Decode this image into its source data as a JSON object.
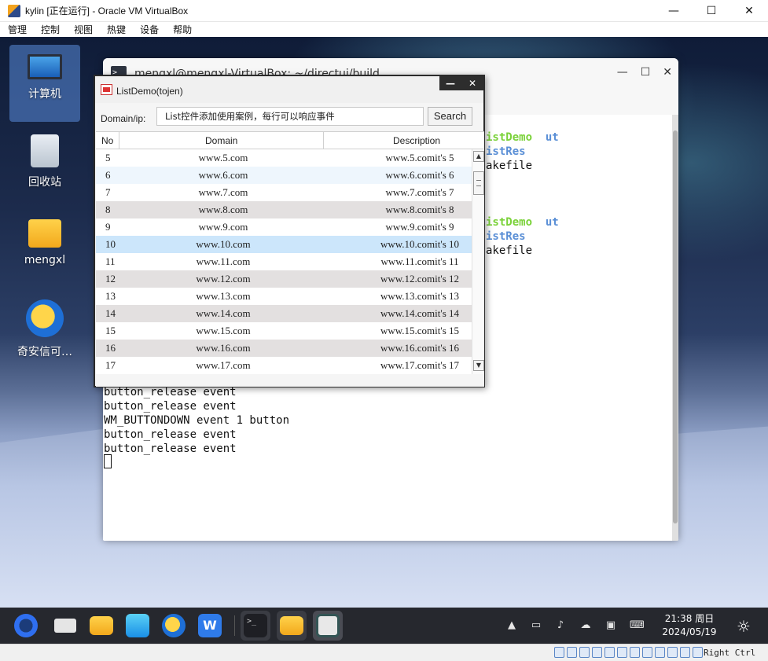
{
  "host_window": {
    "title": "kylin [正在运行] - Oracle VM VirtualBox",
    "menu": [
      "管理",
      "控制",
      "视图",
      "热键",
      "设备",
      "帮助"
    ]
  },
  "desktop_icons": [
    {
      "label": "计算机",
      "icon": "computer-icon"
    },
    {
      "label": "回收站",
      "icon": "recycle-bin-icon"
    },
    {
      "label": "mengxl",
      "icon": "home-folder-icon"
    },
    {
      "label": "奇安信可…",
      "icon": "qianxin-browser-icon"
    }
  ],
  "terminal": {
    "title": "mengxl@mengxl-VirtualBox: ~/directui/build",
    "partial_lines": [
      {
        "green": "istDemo",
        "extra": "ut"
      },
      {
        "blue": "istRes"
      },
      {
        "plain": "akefile"
      },
      {
        "green": "istDemo",
        "extra": "ut"
      },
      {
        "blue": "istRes"
      },
      {
        "plain": "akefile"
      }
    ],
    "lines": [
      "button_release event",
      "button_release event",
      "WM_BUTTONDOWN event 1 button",
      "button_release event",
      "button_release event"
    ]
  },
  "listdemo": {
    "title": "ListDemo(tojen)",
    "domain_label": "Domain/ip:",
    "search_value": "List控件添加使用案例，每行可以响应事件",
    "search_button": "Search",
    "columns": [
      "No",
      "Domain",
      "Description"
    ],
    "rows": [
      {
        "no": "5",
        "domain": "www.5.com",
        "desc": "www.5.comit's 5",
        "style": "white"
      },
      {
        "no": "6",
        "domain": "www.6.com",
        "desc": "www.6.comit's 6",
        "style": "blue"
      },
      {
        "no": "7",
        "domain": "www.7.com",
        "desc": "www.7.comit's 7",
        "style": "white"
      },
      {
        "no": "8",
        "domain": "www.8.com",
        "desc": "www.8.comit's 8",
        "style": "grey"
      },
      {
        "no": "9",
        "domain": "www.9.com",
        "desc": "www.9.comit's 9",
        "style": "white"
      },
      {
        "no": "10",
        "domain": "www.10.com",
        "desc": "www.10.comit's 10",
        "style": "selected"
      },
      {
        "no": "11",
        "domain": "www.11.com",
        "desc": "www.11.comit's 11",
        "style": "white"
      },
      {
        "no": "12",
        "domain": "www.12.com",
        "desc": "www.12.comit's 12",
        "style": "grey"
      },
      {
        "no": "13",
        "domain": "www.13.com",
        "desc": "www.13.comit's 13",
        "style": "white"
      },
      {
        "no": "14",
        "domain": "www.14.com",
        "desc": "www.14.comit's 14",
        "style": "grey"
      },
      {
        "no": "15",
        "domain": "www.15.com",
        "desc": "www.15.comit's 15",
        "style": "white"
      },
      {
        "no": "16",
        "domain": "www.16.com",
        "desc": "www.16.comit's 16",
        "style": "grey"
      },
      {
        "no": "17",
        "domain": "www.17.com",
        "desc": "www.17.comit's 17",
        "style": "white"
      }
    ]
  },
  "taskbar": {
    "clock_time": "21:38 周日",
    "clock_date": "2024/05/19"
  },
  "status_bar": {
    "hostkey": "Right Ctrl"
  },
  "colors": {
    "selected_row": "#cce6fb",
    "alt_row_blue": "#eef6fd",
    "alt_row_grey": "#e3e0e0",
    "terminal_green": "#7bd23a",
    "terminal_blue": "#5a8fd6"
  }
}
